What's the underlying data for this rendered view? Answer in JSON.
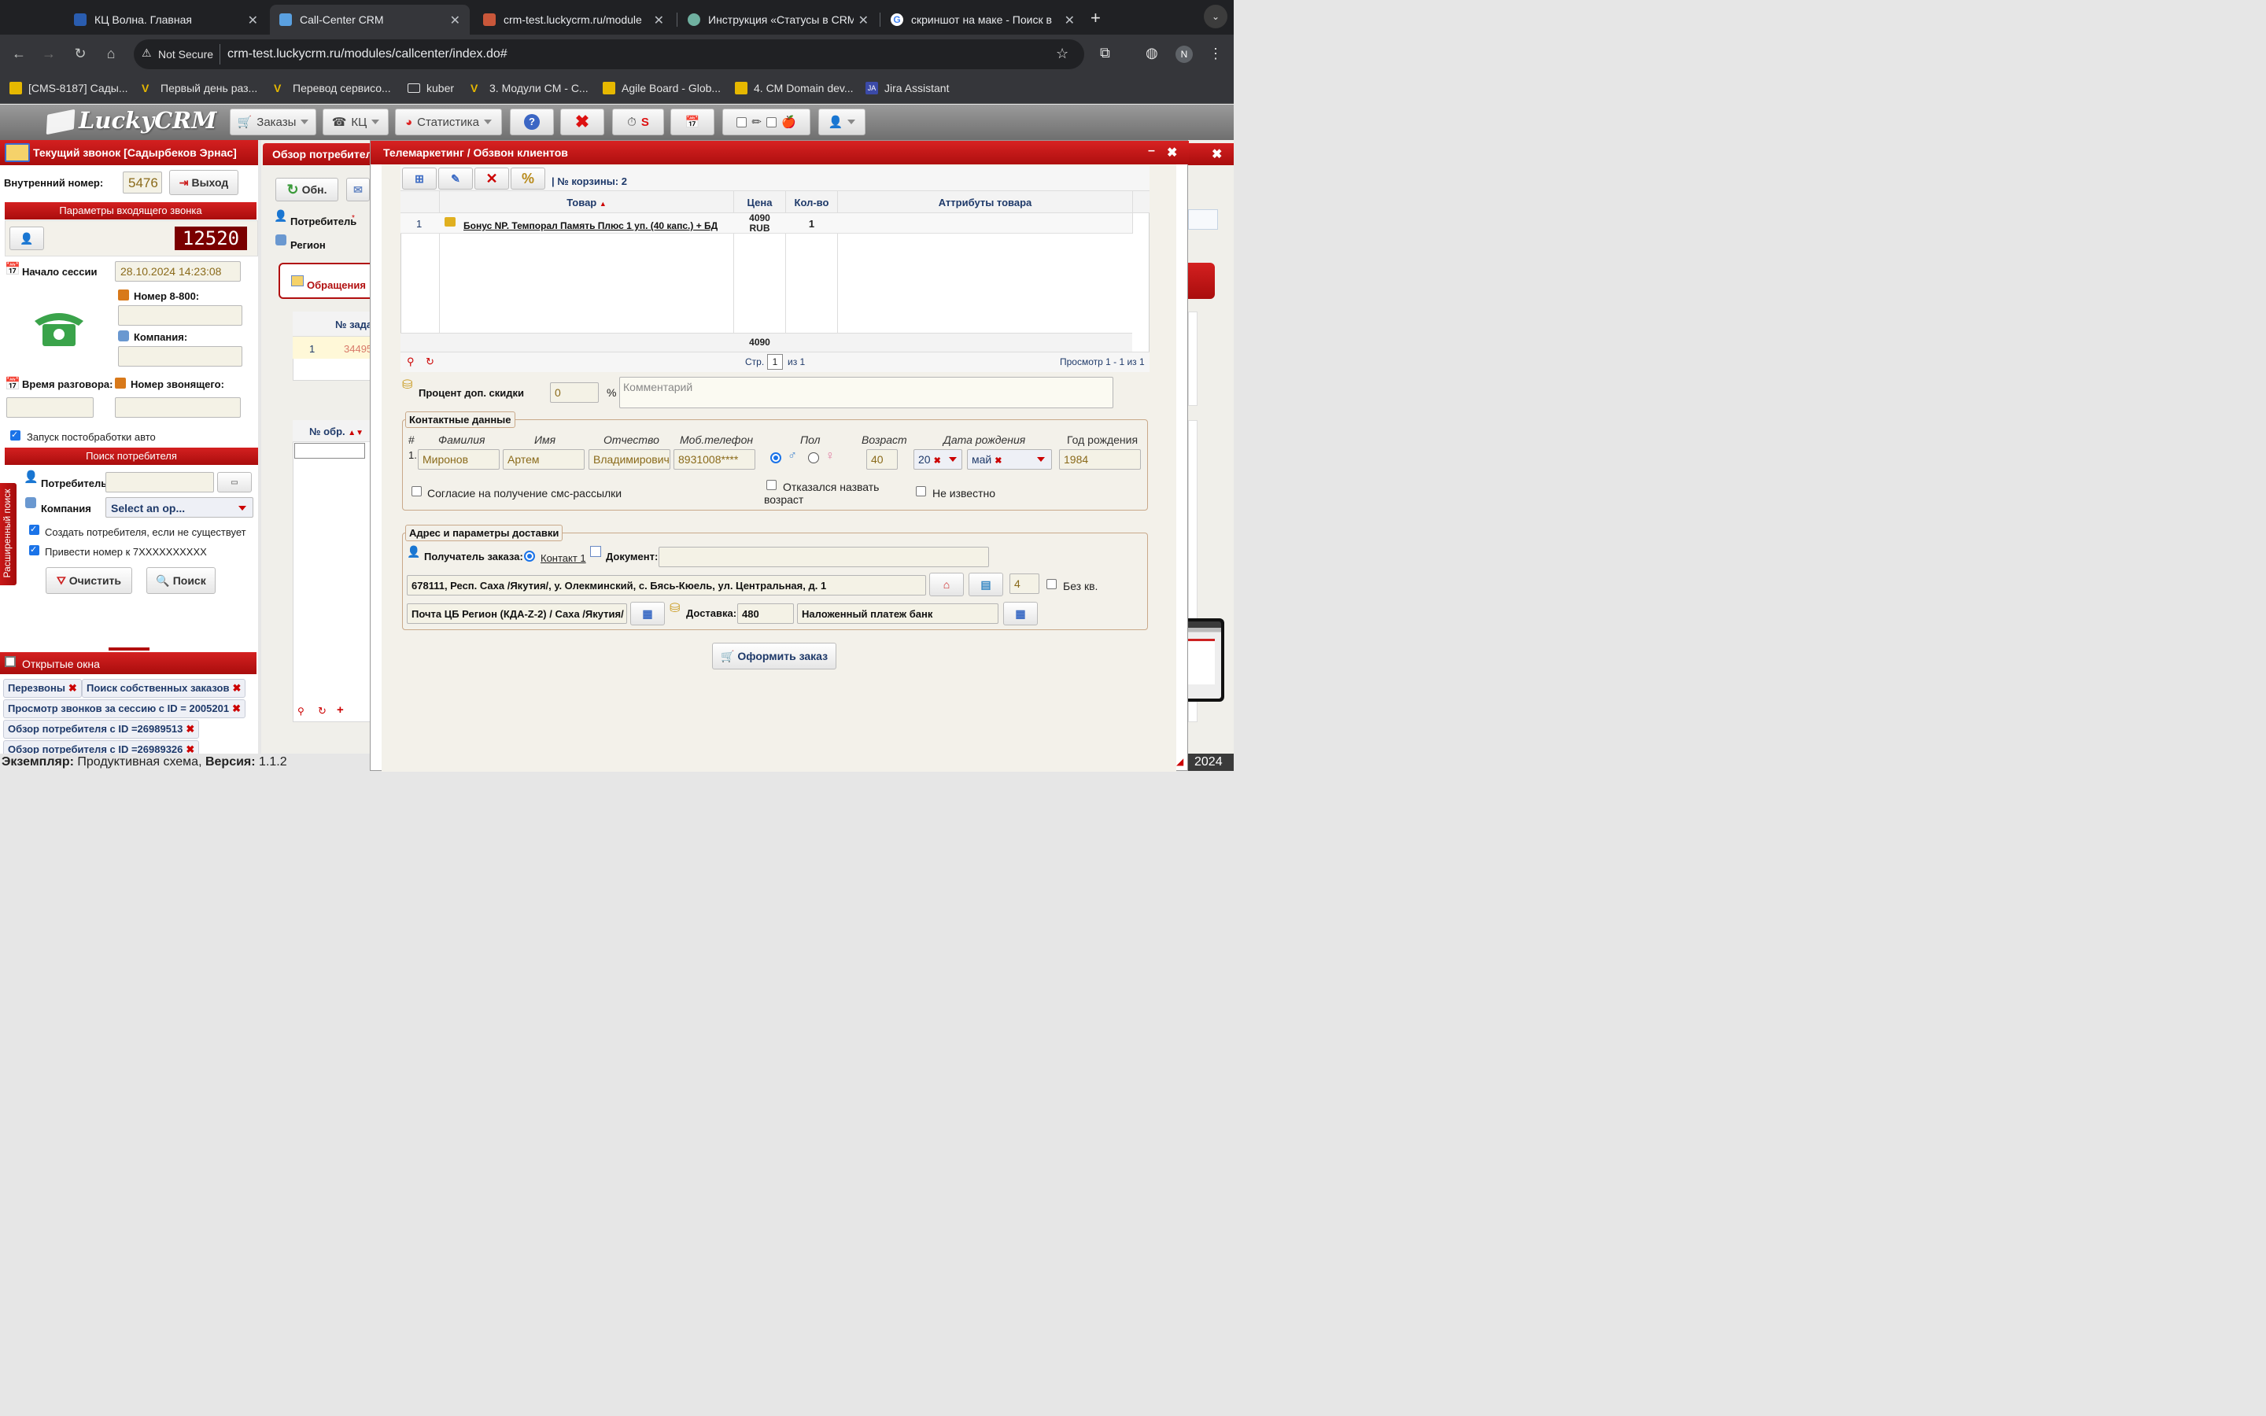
{
  "browser": {
    "tabs": [
      {
        "title": "КЦ Волна. Главная",
        "active": false
      },
      {
        "title": "Call-Center CRM",
        "active": true
      },
      {
        "title": "crm-test.luckycrm.ru/module",
        "active": false
      },
      {
        "title": "Инструкция «Статусы в CRM",
        "active": false
      },
      {
        "title": "скриншот на маке - Поиск в",
        "active": false
      }
    ],
    "security_label": "Not Secure",
    "url": "crm-test.luckycrm.ru/modules/callcenter/index.do#",
    "profile_initial": "N",
    "bookmarks": [
      "[CMS-8187] Сады...",
      "Первый день раз...",
      "Перевод сервисо...",
      "kuber",
      "3. Модули CM - C...",
      "Agile Board - Glob...",
      "4. CM Domain dev...",
      "Jira Assistant"
    ]
  },
  "app": {
    "logo": "LuckyCRM",
    "menu": {
      "orders": "Заказы",
      "kc": "КЦ",
      "stats": "Статистика",
      "s_label": "S"
    }
  },
  "call_panel": {
    "title": "Текущий звонок [Садырбеков Эрнас]",
    "internal_number_label": "Внутренний номер:",
    "internal_number": "5476",
    "exit_label": "Выход",
    "params_header": "Параметры входящего звонка",
    "call_counter": "12520",
    "session_start_label": "Начало сессии",
    "session_start": "28.10.2024 14:23:08",
    "number_800_label": "Номер 8-800:",
    "company_label": "Компания:",
    "talk_time_label": "Время разговора:",
    "caller_number_label": "Номер звонящего:",
    "autopost_label": "Запуск постобработки авто",
    "search_header": "Поиск потребителя",
    "consumer_label": "Потребитель",
    "company_search_label": "Компания",
    "company_select": "Select an op...",
    "create_consumer_label": "Создать потребителя, если не существует",
    "normalize_label": "Привести номер к 7XXXXXXXXXX",
    "clear_label": "Очистить",
    "search_label": "Поиск",
    "extended_search_label": "Расширенный поиск"
  },
  "open_windows": {
    "title": "Открытые окна",
    "items": [
      "Перезвоны",
      "Поиск собственных заказов",
      "Просмотр звонков за сессию с ID = 2005201",
      "Обзор потребителя с ID =26989513",
      "Обзор потребителя с ID =26989326"
    ]
  },
  "footer": {
    "instance_label": "Экземпляр:",
    "instance_value": "Продуктивная схема,",
    "version_label": "Версия:",
    "version_value": "1.1.2",
    "year": "2024"
  },
  "background_panel": {
    "title": "Обзор потребителя",
    "refresh_label": "Обн.",
    "consumer_label": "Потребитель",
    "region_label": "Регион",
    "tab_label": "Обращения",
    "col_task": "№ зада",
    "row_num": "1",
    "row_task": "34495",
    "col_appeal": "№ обр."
  },
  "modal": {
    "title": "Телемаркетинг / Обзвон клиентов",
    "cart_label": "| № корзины: 2",
    "table": {
      "headers": [
        "Товар",
        "Цена",
        "Кол-во",
        "Аттрибуты товара"
      ],
      "rows": [
        {
          "num": "1",
          "product": "Бонус NP. Темпорал Память Плюс 1 уп. (40 капс.) + БД",
          "price": "4090",
          "currency": "RUB",
          "qty": "1"
        }
      ],
      "total": "4090",
      "page_label": "Стр.",
      "page": "1",
      "page_of": "из 1",
      "view_label": "Просмотр 1 - 1 из 1"
    },
    "discount_label": "Процент доп. скидки",
    "discount_value": "0",
    "percent_sign": "%",
    "comment_placeholder": "Комментарий",
    "contact": {
      "title": "Контактные данные",
      "headers": {
        "num": "#",
        "last": "Фамилия",
        "first": "Имя",
        "middle": "Отчество",
        "phone": "Моб.телефон",
        "gender": "Пол",
        "age": "Возраст",
        "birth_date": "Дата рождения",
        "birth_year": "Год рождения"
      },
      "row_num": "1.",
      "last": "Миронов",
      "first": "Артем",
      "middle": "Владимирович",
      "phone": "8931008****",
      "age": "40",
      "birth_day": "20",
      "birth_month": "май",
      "birth_year": "1984",
      "sms_consent": "Согласие на получение смс-рассылки",
      "refused_age": "Отказался назвать возраст",
      "unknown": "Не известно"
    },
    "delivery": {
      "title": "Адрес и параметры доставки",
      "recipient_label": "Получатель заказа:",
      "contact_option": "Контакт 1",
      "document_label": "Документ:",
      "address": "678111, Респ. Саха /Якутия/, у. Олекминский, с. Бясь-Кюель, ул. Центральная, д. 1",
      "apartment_value": "4",
      "no_apartment": "Без кв.",
      "post_office": "Почта ЦБ Регион (КДА-Z-2) / Саха /Якутия/",
      "delivery_label": "Доставка:",
      "delivery_cost": "480",
      "payment": "Наложенный платеж банк"
    },
    "submit_label": "Оформить заказ"
  }
}
